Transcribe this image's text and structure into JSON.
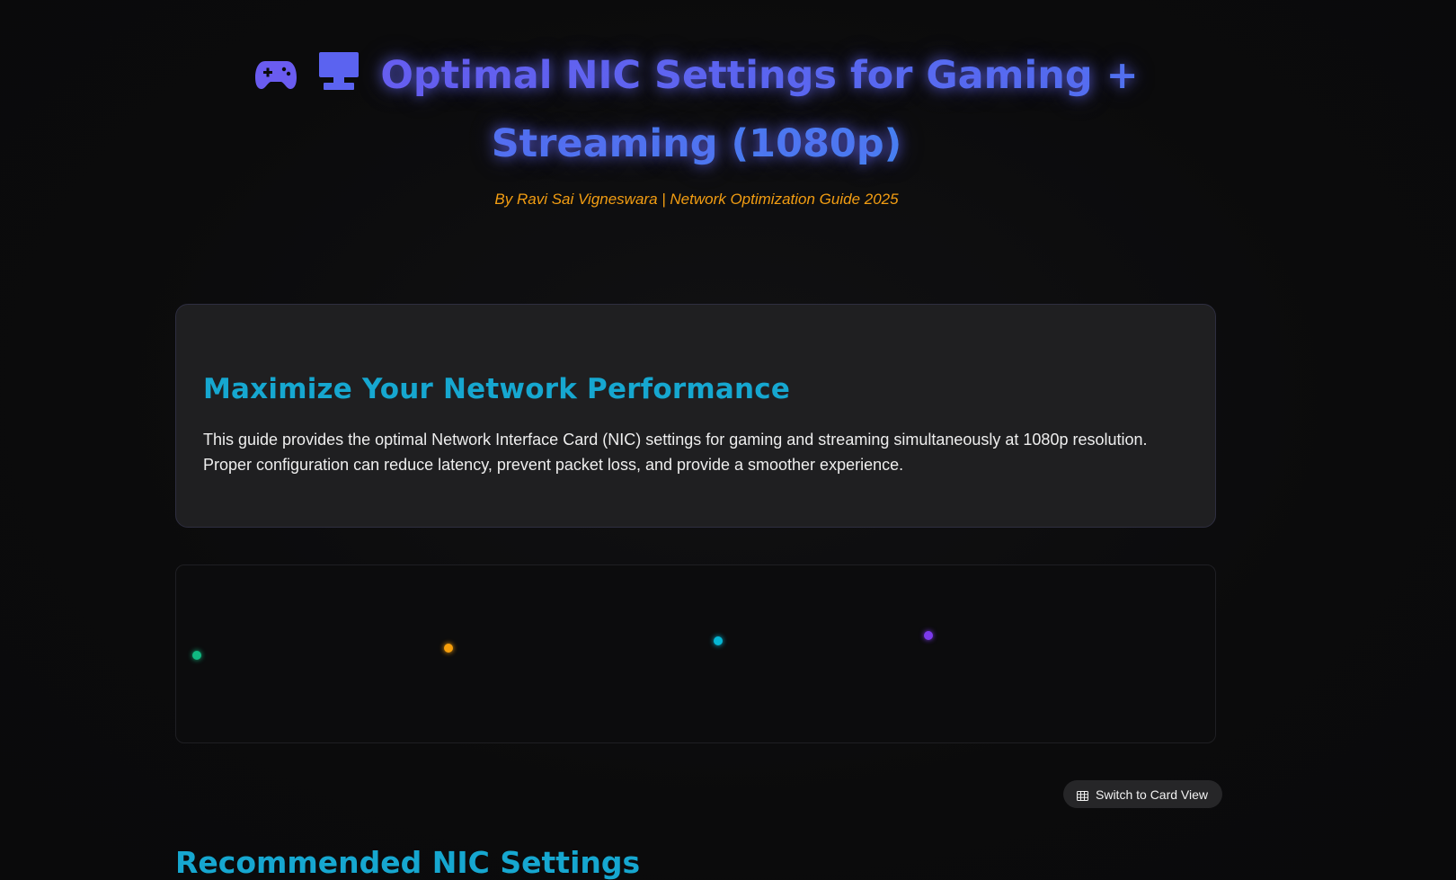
{
  "header": {
    "icons": [
      "gamepad-icon",
      "monitor-icon"
    ],
    "title": "Optimal NIC Settings for Gaming + Streaming (1080p)",
    "subtitle": "By Ravi Sai Vigneswara | Network Optimization Guide 2025"
  },
  "intro": {
    "heading": "Maximize Your Network Performance",
    "body": "This guide provides the optimal Network Interface Card (NIC) settings for gaming and streaming simultaneously at 1080p resolution. Proper configuration can reduce latency, prevent packet loss, and provide a smoother experience."
  },
  "visualization": {
    "dot_colors": [
      "#10b981",
      "#f59e0b",
      "#06b6d4",
      "#7c3aed"
    ]
  },
  "toolbar": {
    "switch_view_label": "Switch to Card View",
    "switch_view_icon": "grid-icon"
  },
  "settings_section": {
    "title": "Recommended NIC Settings"
  },
  "colors": {
    "title_accent": "#5b63f0",
    "subtitle": "#f29d12",
    "heading": "#16a7d0",
    "background": "#0b0b0c"
  }
}
